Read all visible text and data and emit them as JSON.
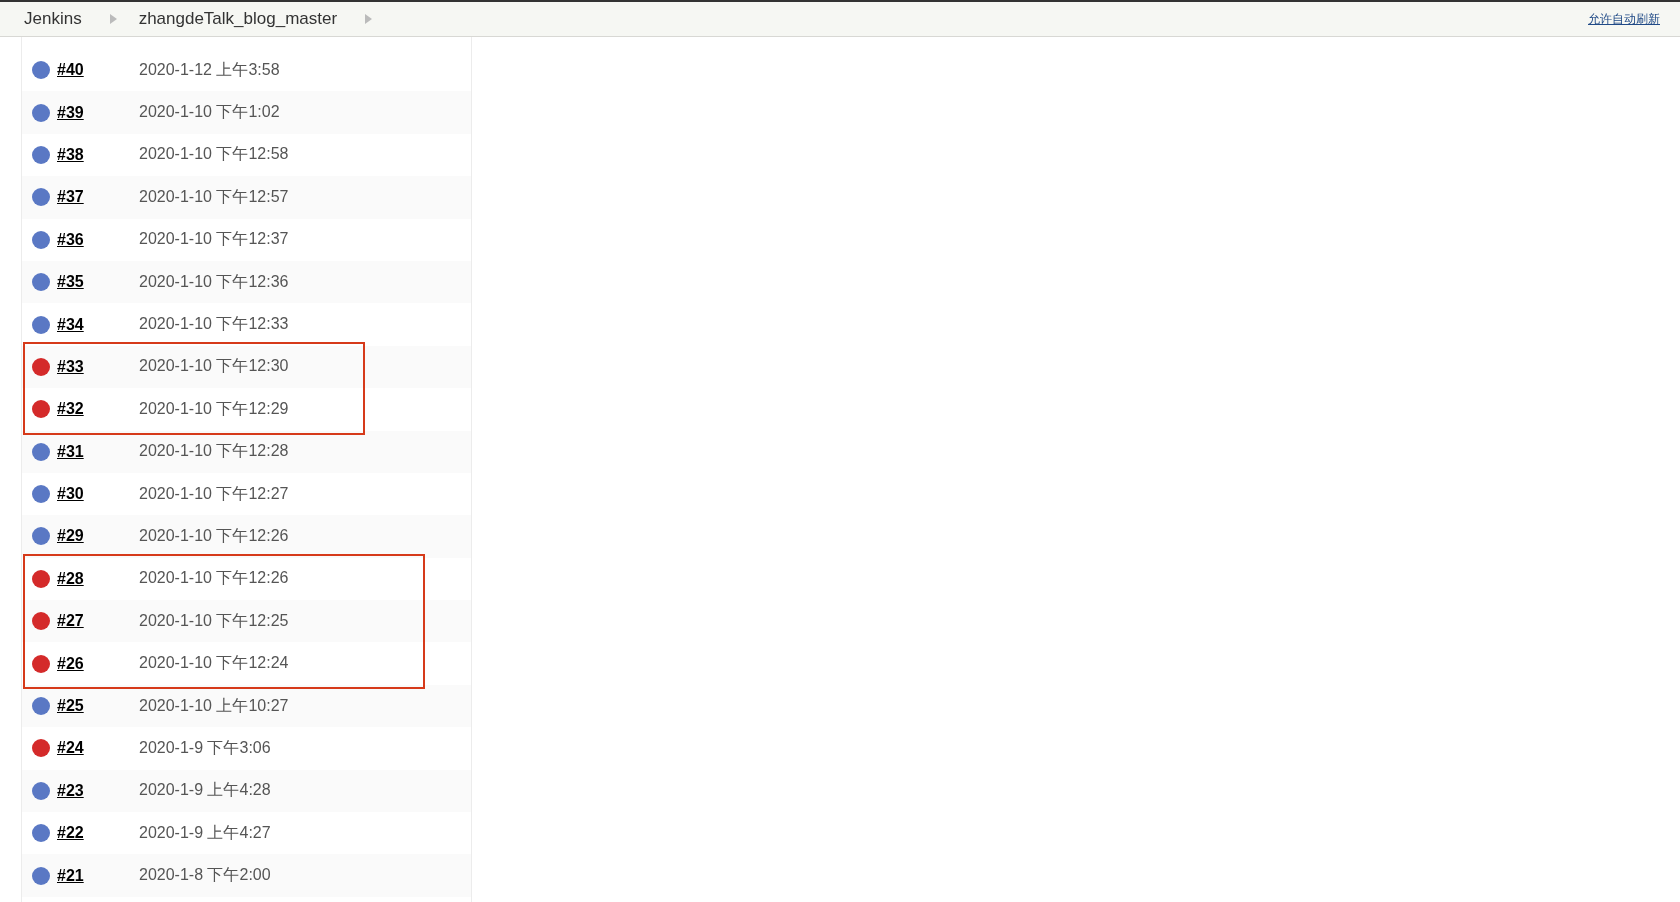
{
  "breadcrumbs": [
    {
      "label": "Jenkins"
    },
    {
      "label": "zhangdeTalk_blog_master"
    }
  ],
  "auto_refresh_link": "允许自动刷新",
  "build_groups": [
    {
      "highlighted": false,
      "builds": [
        {
          "number": "#40",
          "time": "2020-1-12 上午3:58",
          "color": "#5a78c4"
        },
        {
          "number": "#39",
          "time": "2020-1-10 下午1:02",
          "color": "#5a78c4"
        },
        {
          "number": "#38",
          "time": "2020-1-10 下午12:58",
          "color": "#5a78c4"
        },
        {
          "number": "#37",
          "time": "2020-1-10 下午12:57",
          "color": "#5a78c4"
        },
        {
          "number": "#36",
          "time": "2020-1-10 下午12:37",
          "color": "#5a78c4"
        },
        {
          "number": "#35",
          "time": "2020-1-10 下午12:36",
          "color": "#5a78c4"
        },
        {
          "number": "#34",
          "time": "2020-1-10 下午12:33",
          "color": "#5a78c4"
        }
      ]
    },
    {
      "highlighted": true,
      "wide": false,
      "builds": [
        {
          "number": "#33",
          "time": "2020-1-10 下午12:30",
          "color": "#d42a2a"
        },
        {
          "number": "#32",
          "time": "2020-1-10 下午12:29",
          "color": "#d42a2a"
        }
      ]
    },
    {
      "highlighted": false,
      "builds": [
        {
          "number": "#31",
          "time": "2020-1-10 下午12:28",
          "color": "#5a78c4"
        },
        {
          "number": "#30",
          "time": "2020-1-10 下午12:27",
          "color": "#5a78c4"
        },
        {
          "number": "#29",
          "time": "2020-1-10 下午12:26",
          "color": "#5a78c4"
        }
      ]
    },
    {
      "highlighted": true,
      "wide": true,
      "builds": [
        {
          "number": "#28",
          "time": "2020-1-10 下午12:26",
          "color": "#d42a2a"
        },
        {
          "number": "#27",
          "time": "2020-1-10 下午12:25",
          "color": "#d42a2a"
        },
        {
          "number": "#26",
          "time": "2020-1-10 下午12:24",
          "color": "#d42a2a"
        }
      ]
    },
    {
      "highlighted": false,
      "builds": [
        {
          "number": "#25",
          "time": "2020-1-10 上午10:27",
          "color": "#5a78c4"
        },
        {
          "number": "#24",
          "time": "2020-1-9 下午3:06",
          "color": "#d42a2a"
        },
        {
          "number": "#23",
          "time": "2020-1-9 上午4:28",
          "color": "#5a78c4"
        },
        {
          "number": "#22",
          "time": "2020-1-9 上午4:27",
          "color": "#5a78c4"
        },
        {
          "number": "#21",
          "time": "2020-1-8 下午2:00",
          "color": "#5a78c4"
        }
      ]
    }
  ]
}
